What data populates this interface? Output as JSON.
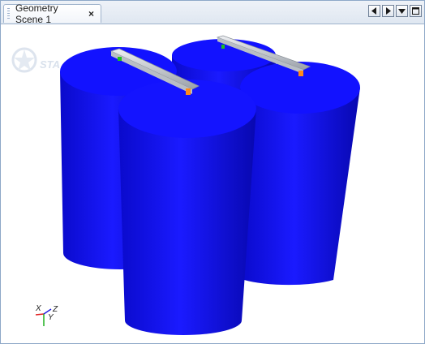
{
  "tab": {
    "title": "Geometry Scene 1",
    "close_glyph": "×"
  },
  "controls": [
    {
      "name": "scroll-left-button",
      "icon": "triangle-left-icon"
    },
    {
      "name": "scroll-right-button",
      "icon": "triangle-right-icon"
    },
    {
      "name": "tab-list-button",
      "icon": "triangle-down-icon"
    },
    {
      "name": "maximize-button",
      "icon": "maximize-icon"
    }
  ],
  "logo": {
    "text": "STA"
  },
  "triad": {
    "x_label": "X",
    "y_label": "Y",
    "z_label": "Z"
  },
  "colors": {
    "cylinder": "#0b0bff",
    "bar": "#c8ccd2",
    "tab_border": "#9fb3cc"
  }
}
